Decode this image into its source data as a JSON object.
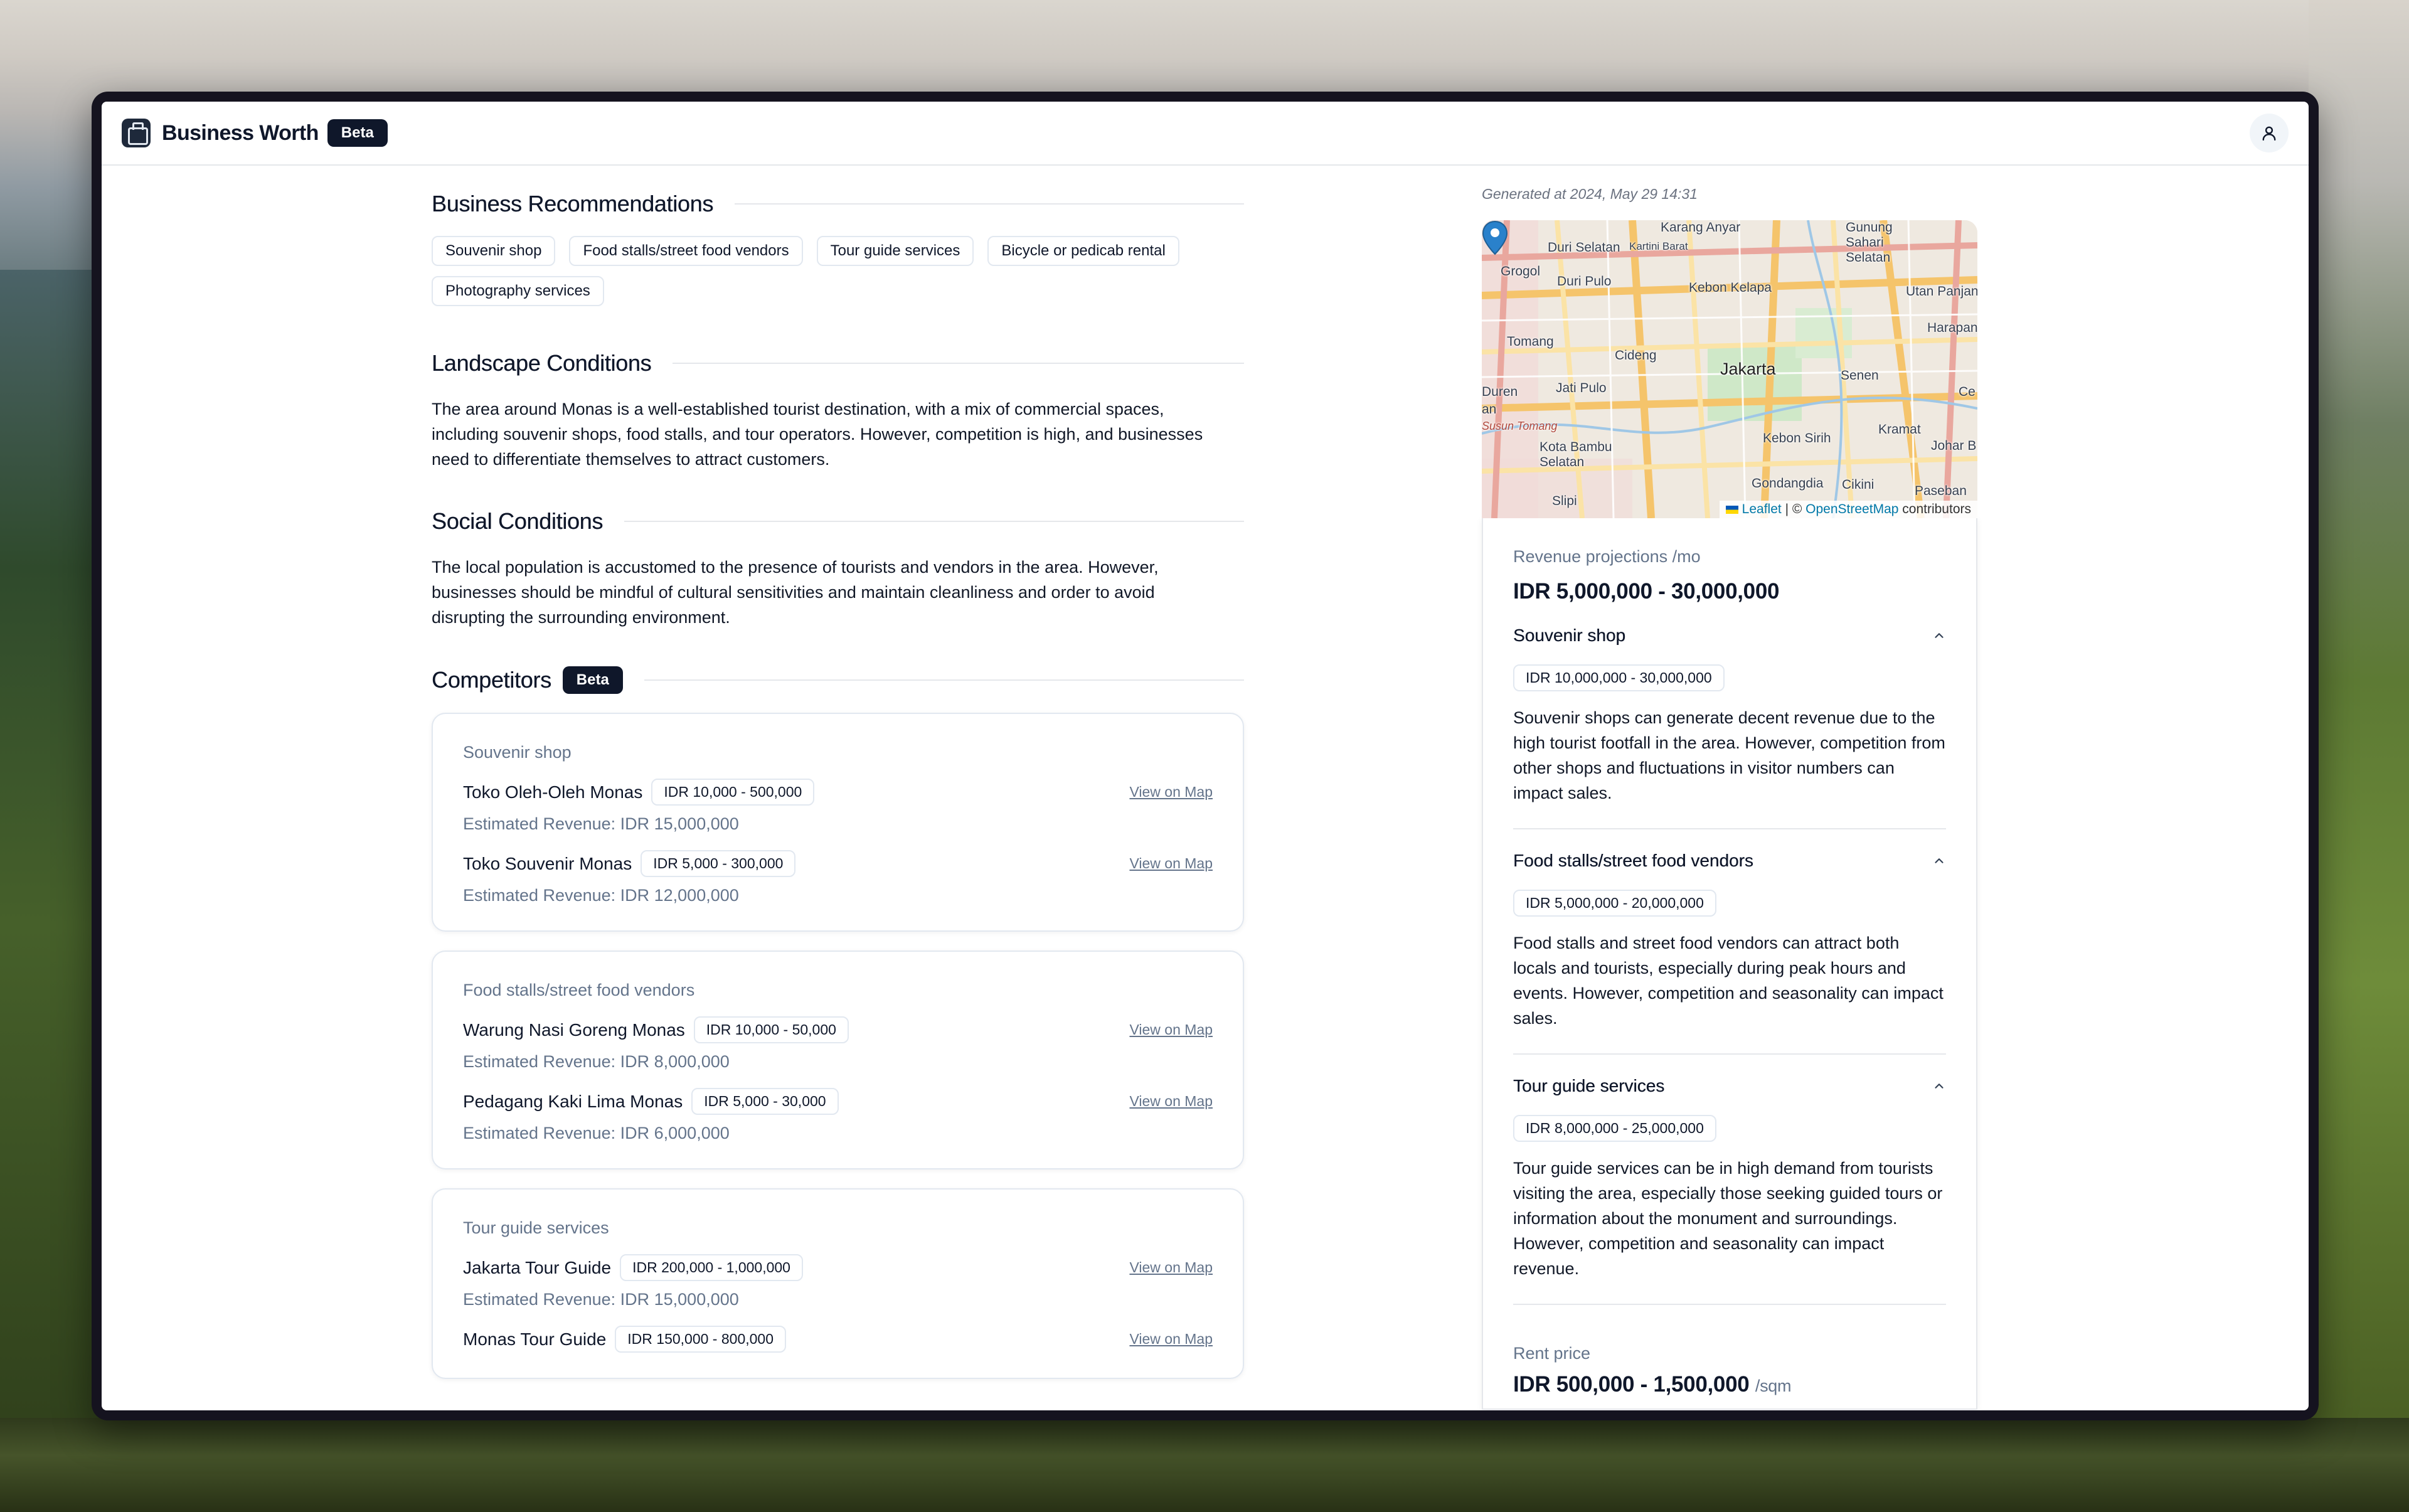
{
  "app": {
    "title": "Business Worth",
    "badge": "Beta"
  },
  "recommendations": {
    "title": "Business Recommendations",
    "items": [
      "Souvenir shop",
      "Food stalls/street food vendors",
      "Tour guide services",
      "Bicycle or pedicab rental",
      "Photography services"
    ]
  },
  "landscape": {
    "title": "Landscape Conditions",
    "text": "The area around Monas is a well-established tourist destination, with a mix of commercial spaces, including souvenir shops, food stalls, and tour operators. However, competition is high, and businesses need to differentiate themselves to attract customers."
  },
  "social": {
    "title": "Social Conditions",
    "text": "The local population is accustomed to the presence of tourists and vendors in the area. However, businesses should be mindful of cultural sensitivities and maintain cleanliness and order to avoid disrupting the surrounding environment."
  },
  "competitors": {
    "title": "Competitors",
    "badge": "Beta",
    "link_label": "View on Map",
    "groups": [
      {
        "category": "Souvenir shop",
        "items": [
          {
            "name": "Toko Oleh-Oleh Monas",
            "price": "IDR 10,000 - 500,000",
            "revenue": "Estimated Revenue: IDR 15,000,000"
          },
          {
            "name": "Toko Souvenir Monas",
            "price": "IDR 5,000 - 300,000",
            "revenue": "Estimated Revenue: IDR 12,000,000"
          }
        ]
      },
      {
        "category": "Food stalls/street food vendors",
        "items": [
          {
            "name": "Warung Nasi Goreng Monas",
            "price": "IDR 10,000 - 50,000",
            "revenue": "Estimated Revenue: IDR 8,000,000"
          },
          {
            "name": "Pedagang Kaki Lima Monas",
            "price": "IDR 5,000 - 30,000",
            "revenue": "Estimated Revenue: IDR 6,000,000"
          }
        ]
      },
      {
        "category": "Tour guide services",
        "items": [
          {
            "name": "Jakarta Tour Guide",
            "price": "IDR 200,000 - 1,000,000",
            "revenue": "Estimated Revenue: IDR 15,000,000"
          },
          {
            "name": "Monas Tour Guide",
            "price": "IDR 150,000 - 800,000",
            "revenue": ""
          }
        ]
      }
    ]
  },
  "report": {
    "generated": "Generated at 2024, May 29 14:31",
    "map": {
      "labels": [
        "Duri Selatan",
        "Grogol",
        "Duri Pulo",
        "Kebon Kelapa",
        "Gunung Sahari Selatan",
        "Utan Panjang",
        "Harapan I",
        "Tomang",
        "Cideng",
        "Jakarta",
        "Senen",
        "Jati Pulo",
        "Duren",
        "Susun Tomang",
        "Kramat",
        "Kebon Sirih",
        "Kota Bambu Selatan",
        "Johar B",
        "Gondangdia",
        "Cikini",
        "Paseban",
        "Slipi",
        "Ce",
        "an",
        "Karang Anyar",
        "Kartini Barat"
      ],
      "attribution": {
        "leaflet": "Leaflet",
        "sep": " | © ",
        "osm": "OpenStreetMap",
        "suffix": " contributors"
      }
    },
    "revenue_label": "Revenue projections /mo",
    "revenue_value": "IDR 5,000,000 - 30,000,000",
    "projections": [
      {
        "title": "Souvenir shop",
        "range": "IDR 10,000,000 - 30,000,000",
        "text": "Souvenir shops can generate decent revenue due to the high tourist footfall in the area. However, competition from other shops and fluctuations in visitor numbers can impact sales."
      },
      {
        "title": "Food stalls/street food vendors",
        "range": "IDR 5,000,000 - 20,000,000",
        "text": "Food stalls and street food vendors can attract both locals and tourists, especially during peak hours and events. However, competition and seasonality can impact sales."
      },
      {
        "title": "Tour guide services",
        "range": "IDR 8,000,000 - 25,000,000",
        "text": "Tour guide services can be in high demand from tourists visiting the area, especially those seeking guided tours or information about the monument and surroundings. However, competition and seasonality can impact revenue."
      }
    ],
    "rent_label": "Rent price",
    "rent_value": "IDR 500,000 - 1,500,000",
    "rent_unit": "/sqm"
  },
  "colors": {
    "primary": "#0f172a",
    "muted": "#64748b",
    "border": "#e2e8f0",
    "link": "#0078a8",
    "pin": "#2a81cb"
  },
  "icons": {
    "logo": "briefcase-logo-icon",
    "user": "user-icon",
    "chevron": "chevron-up-icon",
    "pin": "map-marker-icon"
  }
}
